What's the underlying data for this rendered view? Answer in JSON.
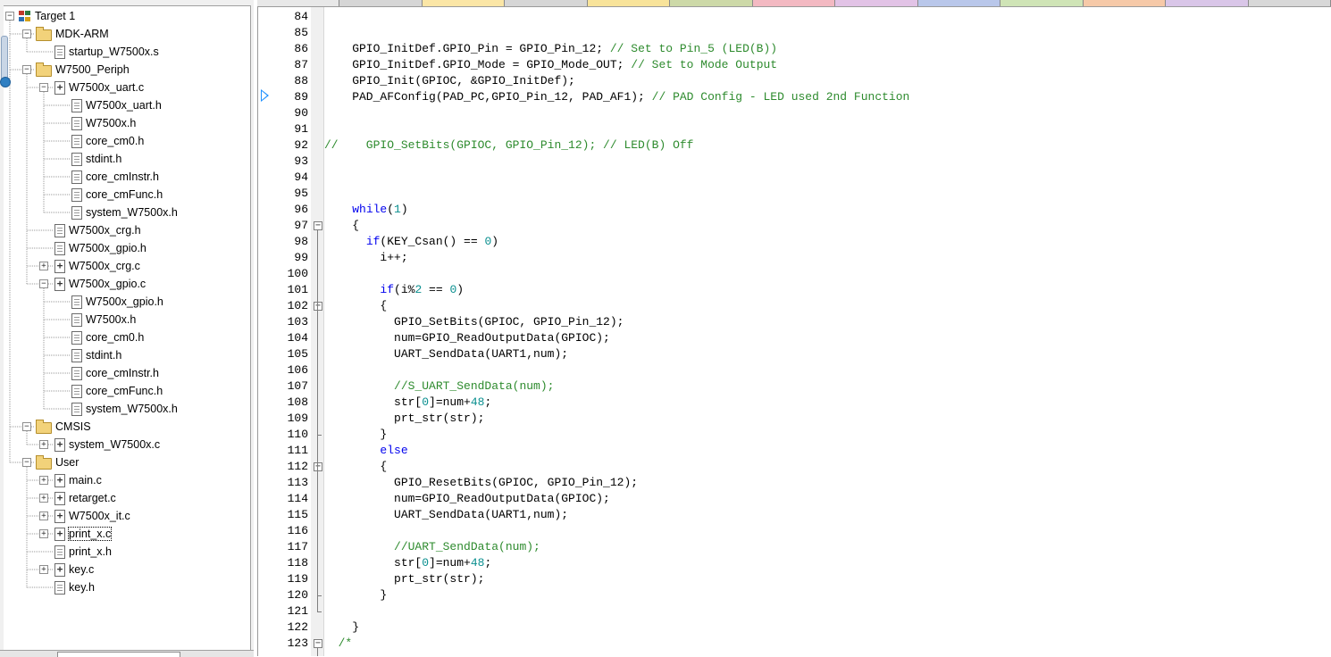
{
  "project_tree": {
    "items": [
      {
        "label": "Target 1",
        "icon": "target-icon",
        "expander": "minus",
        "level": 0
      },
      {
        "label": "MDK-ARM",
        "icon": "folder-icon",
        "expander": "minus",
        "level": 1
      },
      {
        "label": "startup_W7500x.s",
        "icon": "file-icon",
        "expander": "",
        "level": 2
      },
      {
        "label": "W7500_Periph",
        "icon": "folder-icon",
        "expander": "minus",
        "level": 1
      },
      {
        "label": "W7500x_uart.c",
        "icon": "c-file-icon",
        "expander": "minus",
        "level": 2
      },
      {
        "label": "W7500x_uart.h",
        "icon": "file-icon",
        "expander": "",
        "level": 3
      },
      {
        "label": "W7500x.h",
        "icon": "file-icon",
        "expander": "",
        "level": 3
      },
      {
        "label": "core_cm0.h",
        "icon": "file-icon",
        "expander": "",
        "level": 3
      },
      {
        "label": "stdint.h",
        "icon": "file-icon",
        "expander": "",
        "level": 3
      },
      {
        "label": "core_cmInstr.h",
        "icon": "file-icon",
        "expander": "",
        "level": 3
      },
      {
        "label": "core_cmFunc.h",
        "icon": "file-icon",
        "expander": "",
        "level": 3
      },
      {
        "label": "system_W7500x.h",
        "icon": "file-icon",
        "expander": "",
        "level": 3
      },
      {
        "label": "W7500x_crg.h",
        "icon": "file-icon",
        "expander": "",
        "level": 2
      },
      {
        "label": "W7500x_gpio.h",
        "icon": "file-icon",
        "expander": "",
        "level": 2
      },
      {
        "label": "W7500x_crg.c",
        "icon": "c-file-icon",
        "expander": "plus",
        "level": 2
      },
      {
        "label": "W7500x_gpio.c",
        "icon": "c-file-icon",
        "expander": "minus",
        "level": 2
      },
      {
        "label": "W7500x_gpio.h",
        "icon": "file-icon",
        "expander": "",
        "level": 3
      },
      {
        "label": "W7500x.h",
        "icon": "file-icon",
        "expander": "",
        "level": 3
      },
      {
        "label": "core_cm0.h",
        "icon": "file-icon",
        "expander": "",
        "level": 3
      },
      {
        "label": "stdint.h",
        "icon": "file-icon",
        "expander": "",
        "level": 3
      },
      {
        "label": "core_cmInstr.h",
        "icon": "file-icon",
        "expander": "",
        "level": 3
      },
      {
        "label": "core_cmFunc.h",
        "icon": "file-icon",
        "expander": "",
        "level": 3
      },
      {
        "label": "system_W7500x.h",
        "icon": "file-icon",
        "expander": "",
        "level": 3
      },
      {
        "label": "CMSIS",
        "icon": "folder-icon",
        "expander": "minus",
        "level": 1
      },
      {
        "label": "system_W7500x.c",
        "icon": "c-file-icon",
        "expander": "plus",
        "level": 2
      },
      {
        "label": "User",
        "icon": "folder-icon",
        "expander": "minus",
        "level": 1
      },
      {
        "label": "main.c",
        "icon": "c-file-icon",
        "expander": "plus",
        "level": 2
      },
      {
        "label": "retarget.c",
        "icon": "c-file-icon",
        "expander": "plus",
        "level": 2
      },
      {
        "label": "W7500x_it.c",
        "icon": "c-file-icon",
        "expander": "plus",
        "level": 2
      },
      {
        "label": "print_x.c",
        "icon": "c-file-icon",
        "expander": "plus",
        "level": 2,
        "focused": true
      },
      {
        "label": "print_x.h",
        "icon": "file-icon",
        "expander": "",
        "level": 2
      },
      {
        "label": "key.c",
        "icon": "c-file-icon",
        "expander": "plus",
        "level": 2
      },
      {
        "label": "key.h",
        "icon": "file-icon",
        "expander": "",
        "level": 2
      }
    ]
  },
  "editor": {
    "current_line": "89",
    "lines": [
      {
        "n": "84",
        "fold": "",
        "parts": []
      },
      {
        "n": "85",
        "fold": "",
        "parts": []
      },
      {
        "n": "86",
        "fold": "",
        "parts": [
          {
            "t": "    GPIO_InitDef.GPIO_Pin = GPIO_Pin_12; ",
            "c": ""
          },
          {
            "t": "// Set to Pin_5 (LED(B))",
            "c": "cm"
          }
        ]
      },
      {
        "n": "87",
        "fold": "",
        "parts": [
          {
            "t": "    GPIO_InitDef.GPIO_Mode = GPIO_Mode_OUT; ",
            "c": ""
          },
          {
            "t": "// Set to Mode Output",
            "c": "cm"
          }
        ]
      },
      {
        "n": "88",
        "fold": "",
        "parts": [
          {
            "t": "    GPIO_Init(GPIOC, &GPIO_InitDef);",
            "c": ""
          }
        ]
      },
      {
        "n": "89",
        "fold": "",
        "parts": [
          {
            "t": "    PAD_AFConfig(PAD_PC,GPIO_Pin_12, PAD_AF1); ",
            "c": ""
          },
          {
            "t": "// PAD Config - LED used 2nd Function",
            "c": "cm"
          }
        ]
      },
      {
        "n": "90",
        "fold": "",
        "parts": []
      },
      {
        "n": "91",
        "fold": "",
        "parts": []
      },
      {
        "n": "92",
        "fold": "",
        "parts": [
          {
            "t": "//    GPIO_SetBits(GPIOC, GPIO_Pin_12); // LED(B) Off",
            "c": "cm"
          }
        ]
      },
      {
        "n": "93",
        "fold": "",
        "parts": []
      },
      {
        "n": "94",
        "fold": "",
        "parts": []
      },
      {
        "n": "95",
        "fold": "",
        "parts": []
      },
      {
        "n": "96",
        "fold": "",
        "parts": [
          {
            "t": "    ",
            "c": ""
          },
          {
            "t": "while",
            "c": "kw"
          },
          {
            "t": "(",
            "c": ""
          },
          {
            "t": "1",
            "c": "num"
          },
          {
            "t": ")",
            "c": ""
          }
        ]
      },
      {
        "n": "97",
        "fold": "open",
        "parts": [
          {
            "t": "    {",
            "c": ""
          }
        ]
      },
      {
        "n": "98",
        "fold": "",
        "parts": [
          {
            "t": "      ",
            "c": ""
          },
          {
            "t": "if",
            "c": "kw"
          },
          {
            "t": "(KEY_Csan() == ",
            "c": ""
          },
          {
            "t": "0",
            "c": "num"
          },
          {
            "t": ")",
            "c": ""
          }
        ]
      },
      {
        "n": "99",
        "fold": "",
        "parts": [
          {
            "t": "        i++;",
            "c": ""
          }
        ]
      },
      {
        "n": "100",
        "fold": "",
        "parts": []
      },
      {
        "n": "101",
        "fold": "",
        "parts": [
          {
            "t": "        ",
            "c": ""
          },
          {
            "t": "if",
            "c": "kw"
          },
          {
            "t": "(i%",
            "c": ""
          },
          {
            "t": "2",
            "c": "num"
          },
          {
            "t": " == ",
            "c": ""
          },
          {
            "t": "0",
            "c": "num"
          },
          {
            "t": ")",
            "c": ""
          }
        ]
      },
      {
        "n": "102",
        "fold": "open",
        "parts": [
          {
            "t": "        {",
            "c": ""
          }
        ]
      },
      {
        "n": "103",
        "fold": "",
        "parts": [
          {
            "t": "          GPIO_SetBits(GPIOC, GPIO_Pin_12);",
            "c": ""
          }
        ]
      },
      {
        "n": "104",
        "fold": "",
        "parts": [
          {
            "t": "          num=GPIO_ReadOutputData(GPIOC);",
            "c": ""
          }
        ]
      },
      {
        "n": "105",
        "fold": "",
        "parts": [
          {
            "t": "          UART_SendData(UART1,num);",
            "c": ""
          }
        ]
      },
      {
        "n": "106",
        "fold": "",
        "parts": []
      },
      {
        "n": "107",
        "fold": "",
        "parts": [
          {
            "t": "          ",
            "c": ""
          },
          {
            "t": "//S_UART_SendData(num);",
            "c": "cm"
          }
        ]
      },
      {
        "n": "108",
        "fold": "",
        "parts": [
          {
            "t": "          str[",
            "c": ""
          },
          {
            "t": "0",
            "c": "num"
          },
          {
            "t": "]=num+",
            "c": ""
          },
          {
            "t": "48",
            "c": "num"
          },
          {
            "t": ";",
            "c": ""
          }
        ]
      },
      {
        "n": "109",
        "fold": "",
        "parts": [
          {
            "t": "          prt_str(str);",
            "c": ""
          }
        ]
      },
      {
        "n": "110",
        "fold": "end",
        "parts": [
          {
            "t": "        }",
            "c": ""
          }
        ]
      },
      {
        "n": "111",
        "fold": "",
        "parts": [
          {
            "t": "        ",
            "c": ""
          },
          {
            "t": "else",
            "c": "kw"
          }
        ]
      },
      {
        "n": "112",
        "fold": "open",
        "parts": [
          {
            "t": "        {",
            "c": ""
          }
        ]
      },
      {
        "n": "113",
        "fold": "",
        "parts": [
          {
            "t": "          GPIO_ResetBits(GPIOC, GPIO_Pin_12);",
            "c": ""
          }
        ]
      },
      {
        "n": "114",
        "fold": "",
        "parts": [
          {
            "t": "          num=GPIO_ReadOutputData(GPIOC);",
            "c": ""
          }
        ]
      },
      {
        "n": "115",
        "fold": "",
        "parts": [
          {
            "t": "          UART_SendData(UART1,num);",
            "c": ""
          }
        ]
      },
      {
        "n": "116",
        "fold": "",
        "parts": []
      },
      {
        "n": "117",
        "fold": "",
        "parts": [
          {
            "t": "          ",
            "c": ""
          },
          {
            "t": "//UART_SendData(num);",
            "c": "cm"
          }
        ]
      },
      {
        "n": "118",
        "fold": "",
        "parts": [
          {
            "t": "          str[",
            "c": ""
          },
          {
            "t": "0",
            "c": "num"
          },
          {
            "t": "]=num+",
            "c": ""
          },
          {
            "t": "48",
            "c": "num"
          },
          {
            "t": ";",
            "c": ""
          }
        ]
      },
      {
        "n": "119",
        "fold": "",
        "parts": [
          {
            "t": "          prt_str(str);",
            "c": ""
          }
        ]
      },
      {
        "n": "120",
        "fold": "end",
        "parts": [
          {
            "t": "        }",
            "c": ""
          }
        ]
      },
      {
        "n": "121",
        "fold": "end",
        "parts": []
      },
      {
        "n": "122",
        "fold": "",
        "parts": [
          {
            "t": "    }",
            "c": ""
          }
        ]
      },
      {
        "n": "123",
        "fold": "open",
        "parts": [
          {
            "t": "  /*",
            "c": "cm"
          }
        ]
      }
    ]
  },
  "colors": {
    "comment": "#2e8b2e",
    "keyword": "#0000ee",
    "number": "#0a8f8f",
    "exec_arrow": "#1e90ff"
  },
  "editor_tab_colors": [
    "#e8e8e8",
    "#d6d6d6",
    "#fbe6a6",
    "#d6d6d6",
    "#f8e39a",
    "#cdd9a8",
    "#f3b9c2",
    "#e2c3e6",
    "#b9c7ea",
    "#cfe4b6",
    "#f6c9a8",
    "#d9c6e8",
    "#d8d8d8"
  ]
}
